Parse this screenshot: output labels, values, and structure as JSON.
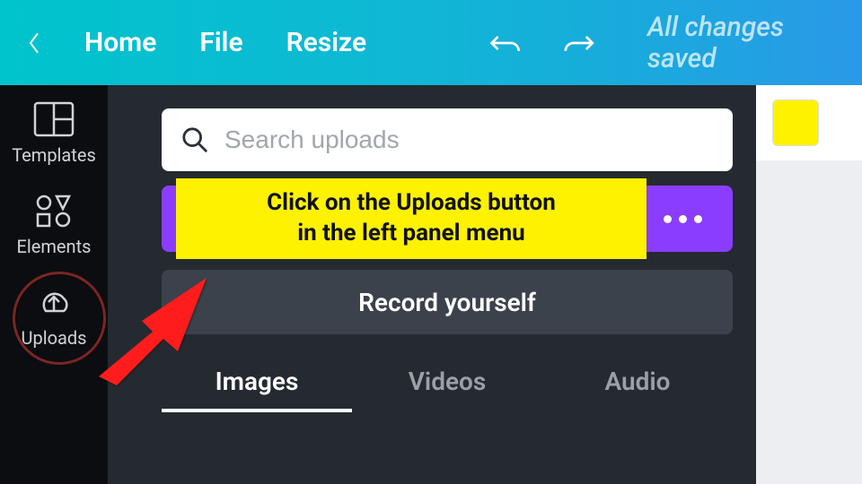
{
  "topbar": {
    "home": "Home",
    "file": "File",
    "resize": "Resize",
    "saved": "All changes saved"
  },
  "rail": {
    "templates": "Templates",
    "elements": "Elements",
    "uploads": "Uploads"
  },
  "panel": {
    "search_placeholder": "Search uploads",
    "record": "Record yourself",
    "tabs": {
      "images": "Images",
      "videos": "Videos",
      "audio": "Audio"
    }
  },
  "callout": {
    "text": "Click on the Uploads button\nin the left panel menu"
  },
  "colors": {
    "accent_purple": "#8b3dff",
    "callout_yellow": "#fff200",
    "swatch": "#fff200"
  }
}
